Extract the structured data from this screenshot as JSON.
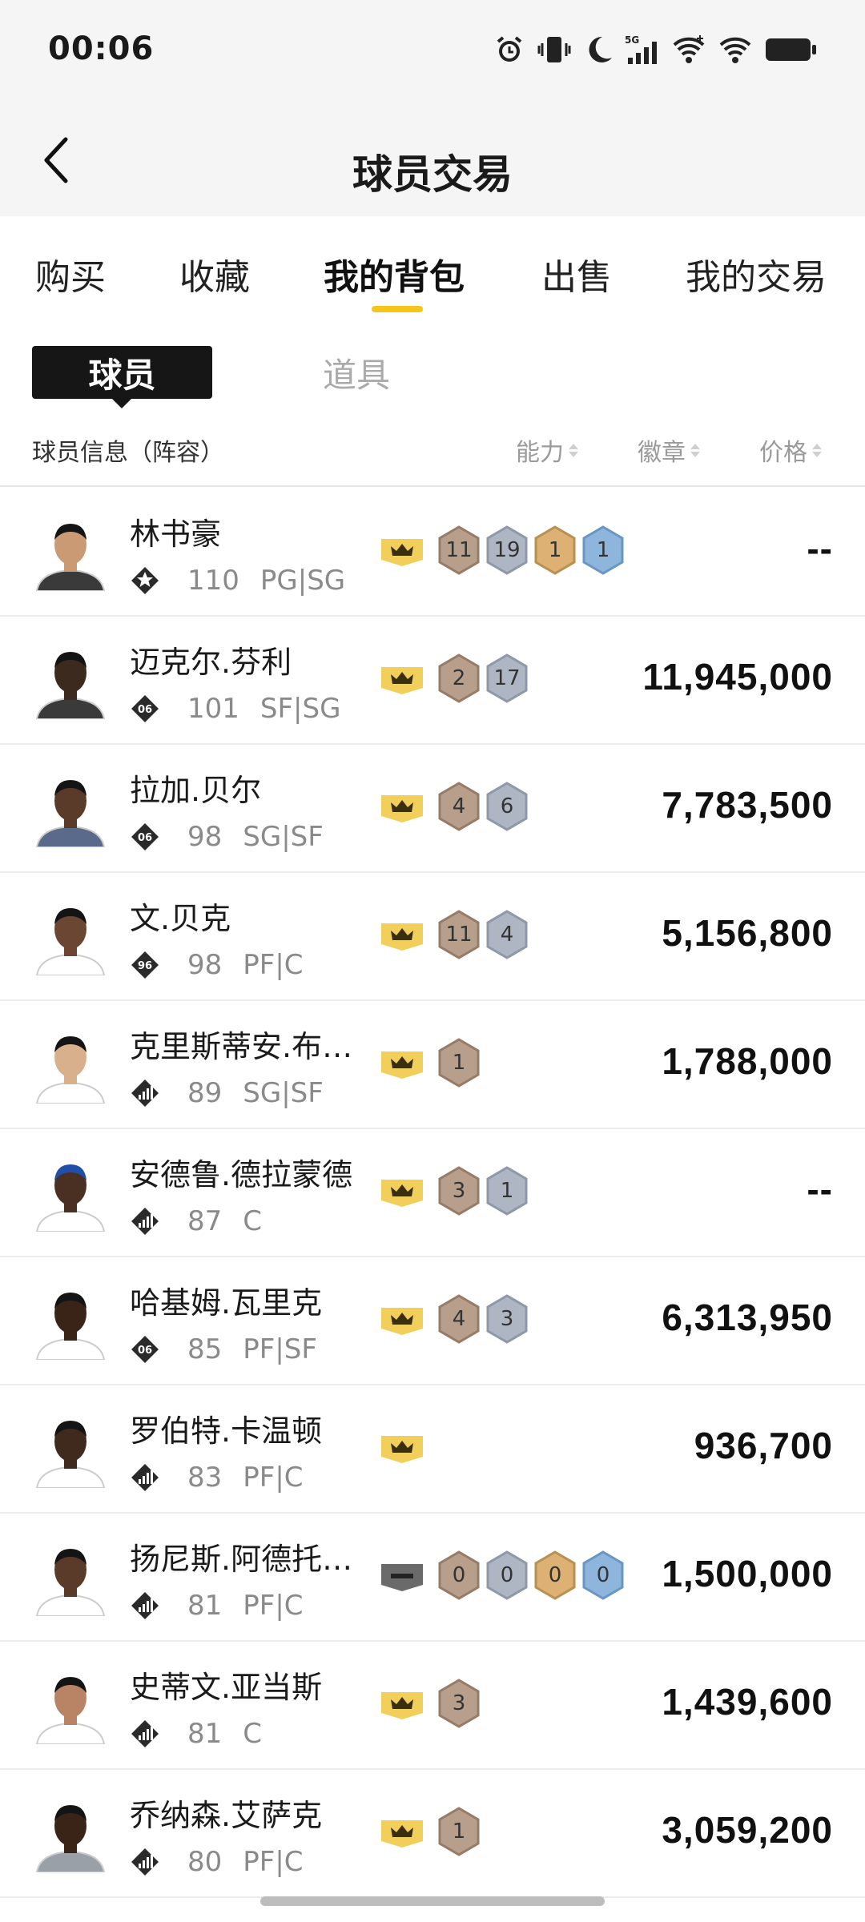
{
  "status_bar": {
    "time": "00:06",
    "network": "5G"
  },
  "header": {
    "title": "球员交易"
  },
  "tabs": [
    {
      "label": "购买"
    },
    {
      "label": "收藏"
    },
    {
      "label": "我的背包",
      "active": true
    },
    {
      "label": "出售"
    },
    {
      "label": "我的交易"
    }
  ],
  "segments": {
    "active": "球员",
    "inactive": "道具"
  },
  "columns": {
    "info": "球员信息（阵容）",
    "ability": "能力",
    "badge": "徽章",
    "price": "价格"
  },
  "colors": {
    "accent": "#f5c518",
    "gold_badge": "#f2cf5b",
    "bronze_hex": "#b79f8b",
    "silver_hex": "#aeb6c4",
    "gold_hex": "#dcb173",
    "blue_hex": "#8eb6dd"
  },
  "players": [
    {
      "name": "林书豪",
      "rank_icon": "star-tier-icon",
      "rating": "110",
      "position": "PG|SG",
      "crown": "crown",
      "hexes": [
        {
          "t": "bronze",
          "v": "11"
        },
        {
          "t": "silver",
          "v": "19"
        },
        {
          "t": "gold",
          "v": "1"
        },
        {
          "t": "blue",
          "v": "1"
        }
      ],
      "price": "--"
    },
    {
      "name": "迈克尔.芬利",
      "rank_icon": "season-06-icon",
      "rating": "101",
      "position": "SF|SG",
      "crown": "crown",
      "hexes": [
        {
          "t": "bronze",
          "v": "2"
        },
        {
          "t": "silver",
          "v": "17"
        }
      ],
      "price": "11,945,000"
    },
    {
      "name": "拉加.贝尔",
      "rank_icon": "season-06-icon",
      "rating": "98",
      "position": "SG|SF",
      "crown": "crown",
      "hexes": [
        {
          "t": "bronze",
          "v": "4"
        },
        {
          "t": "silver",
          "v": "6"
        }
      ],
      "price": "7,783,500"
    },
    {
      "name": "文.贝克",
      "rank_icon": "season-96-icon",
      "rating": "98",
      "position": "PF|C",
      "crown": "crown",
      "hexes": [
        {
          "t": "bronze",
          "v": "11"
        },
        {
          "t": "silver",
          "v": "4"
        }
      ],
      "price": "5,156,800"
    },
    {
      "name": "克里斯蒂安.布…",
      "rank_icon": "signal-tier-icon",
      "rating": "89",
      "position": "SG|SF",
      "crown": "crown",
      "hexes": [
        {
          "t": "bronze",
          "v": "1"
        }
      ],
      "price": "1,788,000"
    },
    {
      "name": "安德鲁.德拉蒙德",
      "rank_icon": "signal-tier-icon",
      "rating": "87",
      "position": "C",
      "crown": "crown",
      "hexes": [
        {
          "t": "bronze",
          "v": "3"
        },
        {
          "t": "silver",
          "v": "1"
        }
      ],
      "price": "--"
    },
    {
      "name": "哈基姆.瓦里克",
      "rank_icon": "season-06-icon",
      "rating": "85",
      "position": "PF|SF",
      "crown": "crown",
      "hexes": [
        {
          "t": "bronze",
          "v": "4"
        },
        {
          "t": "silver",
          "v": "3"
        }
      ],
      "price": "6,313,950"
    },
    {
      "name": "罗伯特.卡温顿",
      "rank_icon": "signal-tier-icon",
      "rating": "83",
      "position": "PF|C",
      "crown": "crown",
      "hexes": [],
      "price": "936,700"
    },
    {
      "name": "扬尼斯.阿德托…",
      "rank_icon": "signal-tier-icon",
      "rating": "81",
      "position": "PF|C",
      "crown": "none",
      "hexes": [
        {
          "t": "bronze",
          "v": "0"
        },
        {
          "t": "silver",
          "v": "0"
        },
        {
          "t": "gold",
          "v": "0"
        },
        {
          "t": "blue",
          "v": "0"
        }
      ],
      "price": "1,500,000"
    },
    {
      "name": "史蒂文.亚当斯",
      "rank_icon": "signal-tier-icon",
      "rating": "81",
      "position": "C",
      "crown": "crown",
      "hexes": [
        {
          "t": "bronze",
          "v": "3"
        }
      ],
      "price": "1,439,600"
    },
    {
      "name": "乔纳森.艾萨克",
      "rank_icon": "signal-tier-icon",
      "rating": "80",
      "position": "PF|C",
      "crown": "crown",
      "hexes": [
        {
          "t": "bronze",
          "v": "1"
        }
      ],
      "price": "3,059,200"
    }
  ]
}
